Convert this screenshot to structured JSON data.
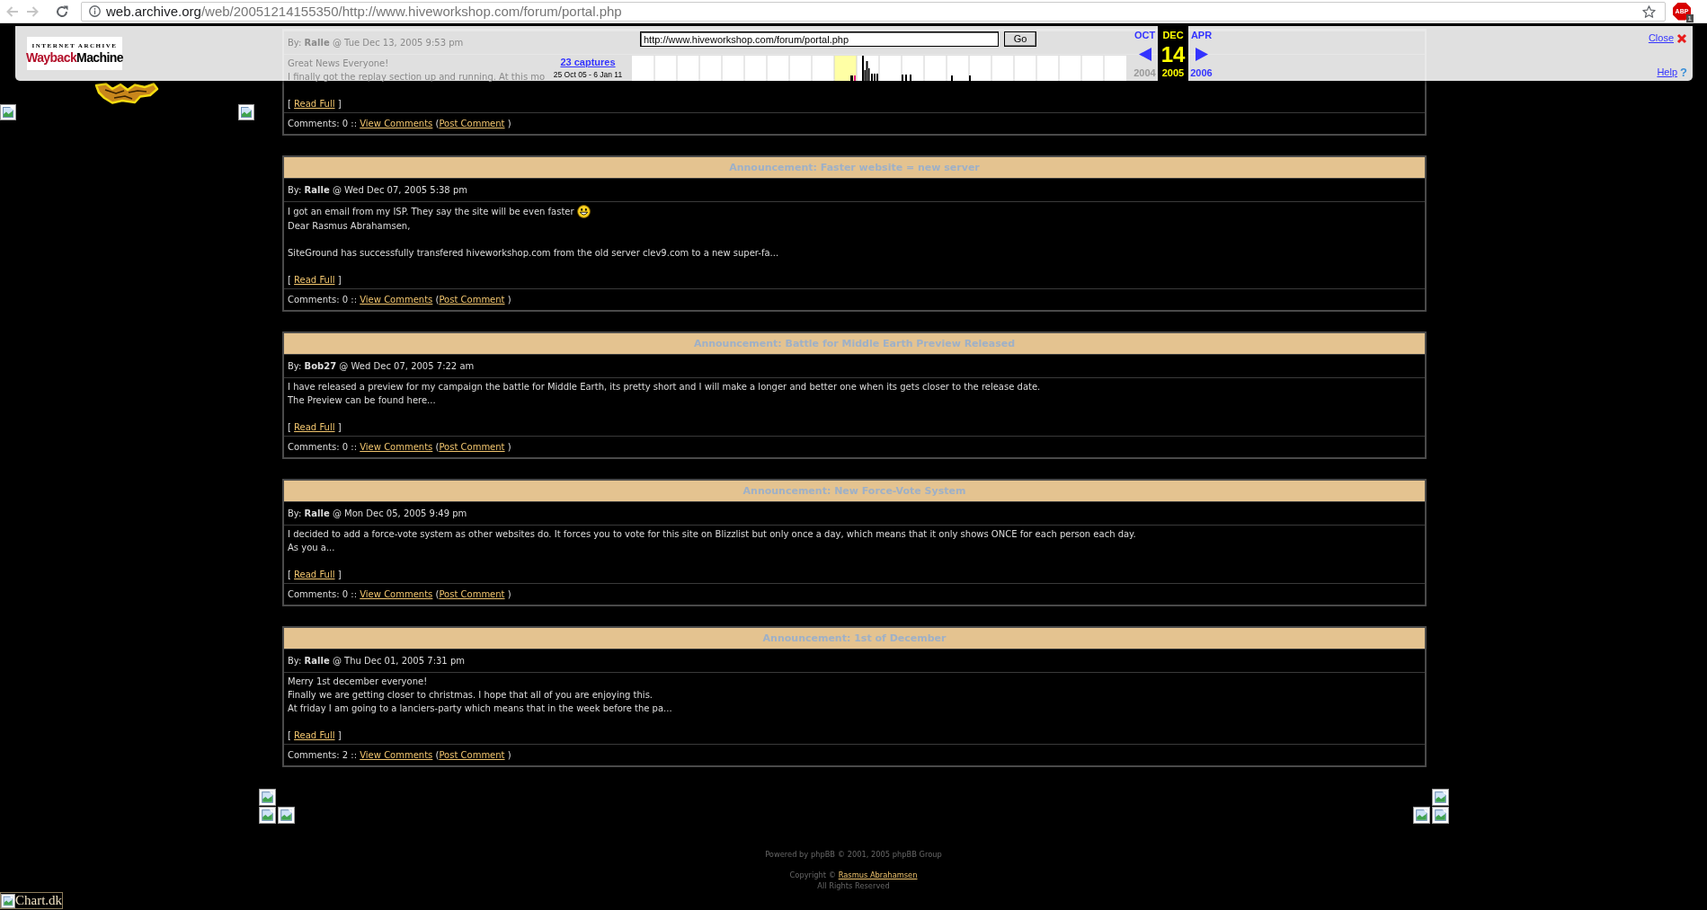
{
  "browser": {
    "nav_buttons": [
      {
        "kind": "back",
        "disabled": true
      },
      {
        "kind": "forward",
        "disabled": true
      },
      {
        "kind": "reload",
        "disabled": false
      }
    ],
    "address": {
      "host": "web.archive.org",
      "path": "/web/20051214155350/http://www.hiveworkshop.com/forum/portal.php"
    },
    "bookmarked": false,
    "extension": {
      "label": "ABP",
      "badge": "1"
    }
  },
  "wayback_toolbar": {
    "logo": {
      "caption": "INTERNET ARCHIVE",
      "wordmark": [
        "Wayback",
        "Machine"
      ]
    },
    "captures": {
      "link": "23 captures",
      "range": "25 Oct 05 - 6 Jan 11"
    },
    "url_field": {
      "value": "http://www.hiveworkshop.com/forum/portal.php"
    },
    "go_button": "Go",
    "calendar": [
      {
        "kind": "prev",
        "month": "OCT",
        "year": "2004",
        "year_enabled": false
      },
      {
        "kind": "current",
        "month": "DEC",
        "day": "14",
        "year": "2005",
        "year_enabled": true
      },
      {
        "kind": "next",
        "month": "APR",
        "year": "2006",
        "year_enabled": true
      }
    ],
    "close_link": "Close",
    "help_link": "Help",
    "help_icon": "?"
  },
  "posts": [
    {
      "byline": "By: **Ralle** @ Tue Dec 13, 2005 9:53 pm",
      "body": [
        [
          {
            "text": "Great News Everyone!",
            "smiley": false
          },
          {
            "text": "I finally got the replay section up and running. At this mo",
            "smiley": false
          }
        ]
      ],
      "read_full": {
        "open": "[",
        "link": "Read Full",
        "close": "]"
      },
      "comments": {
        "count": "Comments: 0 ::",
        "view_link": "View Comments",
        "open": "(",
        "post_link": "Post Comment",
        "close": ")"
      }
    },
    {
      "title": "Announcement: Faster website = new server",
      "byline": "By: **Ralle** @ Wed Dec 07, 2005 5:38 pm",
      "body": [
        [
          {
            "text": "I got an email from my ISP. They say the site will be even faster",
            "smiley": true
          },
          {
            "text": "Dear Rasmus Abrahamsen,",
            "smiley": false
          }
        ],
        [
          {
            "text": "SiteGround has successfully transfered hiveworkshop.com from the old server clev9.com to a new super-fa...",
            "smiley": false
          }
        ]
      ],
      "read_full": {
        "open": "[",
        "link": "Read Full",
        "close": "]"
      },
      "comments": {
        "count": "Comments: 0 ::",
        "view_link": "View Comments",
        "open": "(",
        "post_link": "Post Comment",
        "close": ")"
      }
    },
    {
      "title": "Announcement: Battle for Middle Earth Preview Released",
      "byline": "By: **Bob27** @ Wed Dec 07, 2005 7:22 am",
      "body": [
        [
          {
            "text": "I have released a preview for my campaign the battle for Middle Earth, its pretty short and I will make a longer and better one when its gets closer to the release date.",
            "smiley": false
          },
          {
            "text": "The Preview can be found here...",
            "smiley": false
          }
        ]
      ],
      "read_full": {
        "open": "[",
        "link": "Read Full",
        "close": "]"
      },
      "comments": {
        "count": "Comments: 0 ::",
        "view_link": "View Comments",
        "open": "(",
        "post_link": "Post Comment",
        "close": ")"
      }
    },
    {
      "title": "Announcement: New Force-Vote System",
      "byline": "By: **Ralle** @ Mon Dec 05, 2005 9:49 pm",
      "body": [
        [
          {
            "text": "I decided to add a force-vote system as other websites do. It forces you to vote for this site on Blizzlist but only once a day, which means that it only shows ONCE for each person each day.",
            "smiley": false
          },
          {
            "text": "As you a...",
            "smiley": false
          }
        ]
      ],
      "read_full": {
        "open": "[",
        "link": "Read Full",
        "close": "]"
      },
      "comments": {
        "count": "Comments: 0 ::",
        "view_link": "View Comments",
        "open": "(",
        "post_link": "Post Comment",
        "close": ")"
      }
    },
    {
      "title": "Announcement: 1st of December",
      "byline": "By: **Ralle** @ Thu Dec 01, 2005 7:31 pm",
      "body": [
        [
          {
            "text": "Merry 1st december everyone!",
            "smiley": false
          },
          {
            "text": "Finally we are getting closer to christmas. I hope that all of you are enjoying this.",
            "smiley": false
          },
          {
            "text": "At friday I am going to a lanciers-party which means that in the week before the pa...",
            "smiley": false
          }
        ]
      ],
      "read_full": {
        "open": "[",
        "link": "Read Full",
        "close": "]"
      },
      "comments": {
        "count": "Comments: 2 ::",
        "view_link": "View Comments",
        "open": "(",
        "post_link": "Post Comment",
        "close": ")"
      }
    }
  ],
  "footer": {
    "powered_by": "Powered by phpBB © 2001, 2005 phpBB Group",
    "copyright": {
      "text": "Copyright ©",
      "link": "Rasmus Abrahamsen"
    },
    "rights": "All Rights Reserved"
  },
  "counter_image": {
    "alt": "Chart.dk"
  }
}
